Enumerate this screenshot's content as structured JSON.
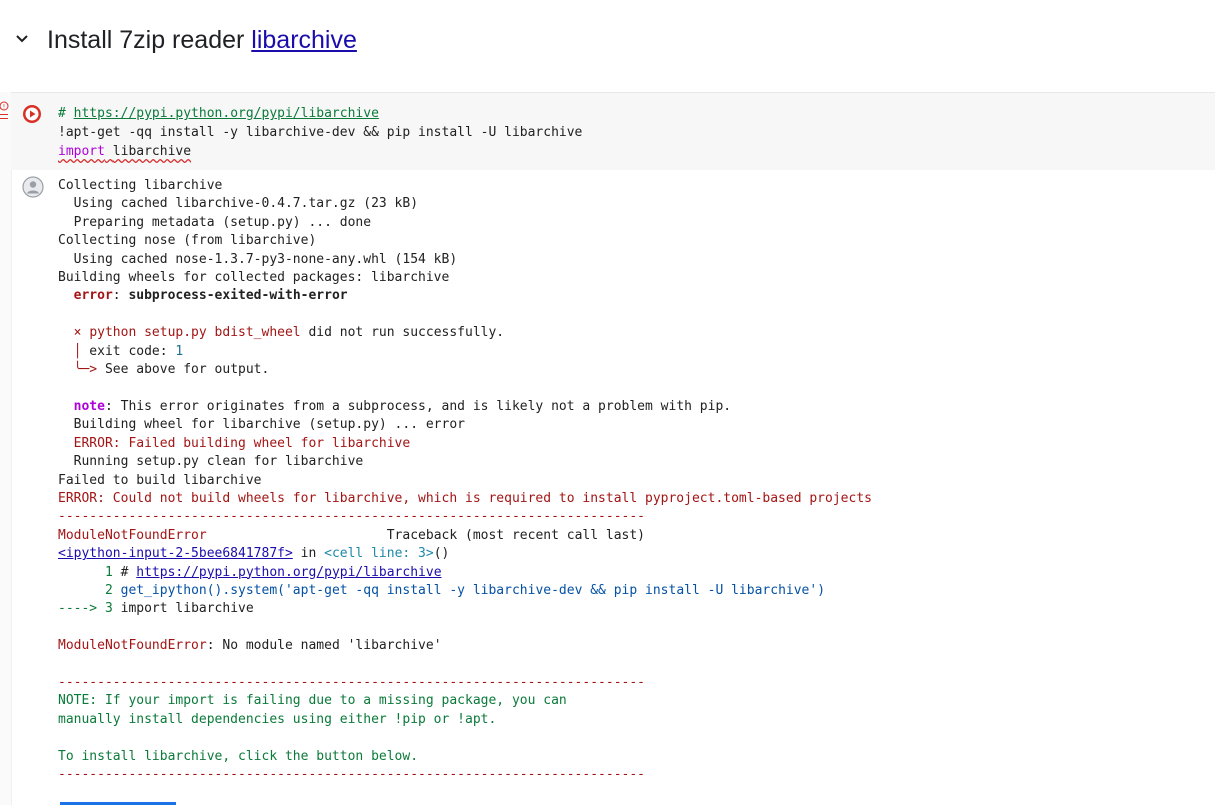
{
  "section": {
    "title_prefix": "Install 7zip reader ",
    "title_link": "libarchive"
  },
  "code_cell": {
    "line1_hash": "# ",
    "line1_url": "https://pypi.python.org/pypi/libarchive",
    "line2": "!apt-get -qq install -y libarchive-dev && pip install -U libarchive",
    "line3_kw": "import",
    "line3_mod": "libarchive"
  },
  "output": {
    "l1": "Collecting libarchive",
    "l2": "  Using cached libarchive-0.4.7.tar.gz (23 kB)",
    "l3": "  Preparing metadata (setup.py) ... done",
    "l4": "Collecting nose (from libarchive)",
    "l5": "  Using cached nose-1.3.7-py3-none-any.whl (154 kB)",
    "l6": "Building wheels for collected packages: libarchive",
    "l7_label": "error",
    "l7_text": "subprocess-exited-with-error",
    "l9_mark": "×",
    "l9_cmd": "python setup.py bdist_wheel",
    "l9_text": " did not run successfully.",
    "l10_bar": "│",
    "l10_text": " exit code: ",
    "l10_code": "1",
    "l11_arrow": "╰─>",
    "l11_text": " See above for output.",
    "l13_label": "note",
    "l13_text": ": This error originates from a subprocess, and is likely not a problem with pip.",
    "l14": "  Building wheel for libarchive (setup.py) ... error",
    "l15": "  ERROR: Failed building wheel for libarchive",
    "l16": "  Running setup.py clean for libarchive",
    "l17": "Failed to build libarchive",
    "l18": "ERROR: Could not build wheels for libarchive, which is required to install pyproject.toml-based projects",
    "dashes": "---------------------------------------------------------------------------",
    "tb_error": "ModuleNotFoundError",
    "tb_header": "                       Traceback (most recent call last)",
    "tb_input": "<ipython-input-2-5bee6841787f>",
    "tb_in": " in ",
    "tb_cell": "<cell line: 3>",
    "tb_paren": "()",
    "tb_line1_num": "      1 ",
    "tb_line1_hash": "# ",
    "tb_line1_url": "https://pypi.python.org/pypi/libarchive",
    "tb_line2_num": "      2 ",
    "tb_line2_text": "get_ipython().system('apt-get -qq install -y libarchive-dev && pip install -U libarchive')",
    "tb_line3_arrow": "----> 3 ",
    "tb_line3_text": "import libarchive",
    "final_error": "ModuleNotFoundError",
    "final_text": ": No module named 'libarchive'",
    "note_dashes": "---------------------------------------------------------------------------",
    "note1": "NOTE: If your import is failing due to a missing package, you can",
    "note2": "manually install dependencies using either !pip or !apt.",
    "note3": "To install libarchive, click the button below.",
    "note_dashes2": "---------------------------------------------------------------------------"
  }
}
